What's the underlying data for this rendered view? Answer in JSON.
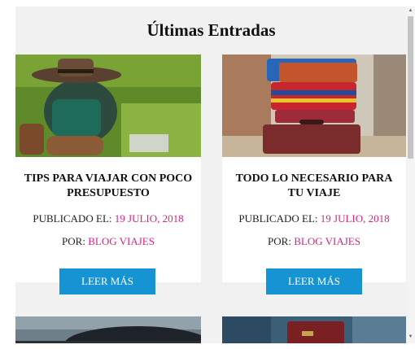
{
  "section": {
    "title": "Últimas Entradas"
  },
  "posts": [
    {
      "title": "TIPS PARA VIAJAR CON POCO PRESUPUESTO",
      "published_label": "PUBLICADO EL:",
      "date": "19 JULIO, 2018",
      "author_label": "POR:",
      "author": "BLOG VIAJES",
      "button_label": "LEER MÁS",
      "image": "hat-backpack-boots-on-grass"
    },
    {
      "title": "TODO LO NECESARIO PARA TU VIAJE",
      "published_label": "PUBLICADO EL:",
      "date": "19 JULIO, 2018",
      "author_label": "POR:",
      "author": "BLOG VIAJES",
      "button_label": "LEER MÁS",
      "image": "stacked-vintage-suitcases"
    }
  ],
  "next_row_images": [
    "sky-landscape",
    "passport-in-pocket"
  ],
  "colors": {
    "accent": "#d6267e",
    "button": "#1593d3",
    "background": "#f1f1f1"
  }
}
